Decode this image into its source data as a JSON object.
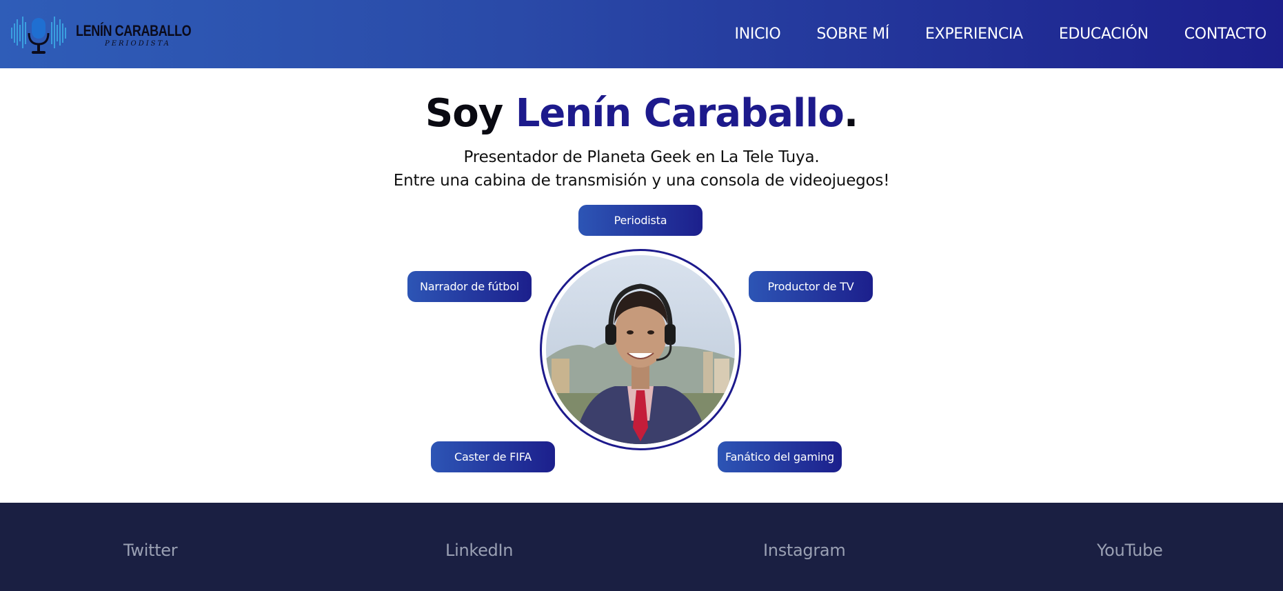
{
  "brand": {
    "name": "LENÍN CARABALLO",
    "tagline": "PERIODISTA",
    "accent_color": "#1d1a8c"
  },
  "nav": {
    "items": [
      "INICIO",
      "SOBRE MÍ",
      "EXPERIENCIA",
      "EDUCACIÓN",
      "CONTACTO"
    ]
  },
  "hero": {
    "title_prefix": "Soy ",
    "title_name": "Lenín Caraballo",
    "title_suffix": ".",
    "line1": "Presentador de Planeta Geek en La Tele Tuya.",
    "line2": "Entre una cabina de transmisión y una consola de videojuegos!"
  },
  "roles": {
    "top": "Periodista",
    "left_upper": "Narrador de fútbol",
    "right_upper": "Productor de TV",
    "left_lower": "Caster de FIFA",
    "right_lower": "Fanático del gaming"
  },
  "footer": {
    "links": [
      "Twitter",
      "LinkedIn",
      "Instagram",
      "YouTube"
    ]
  }
}
